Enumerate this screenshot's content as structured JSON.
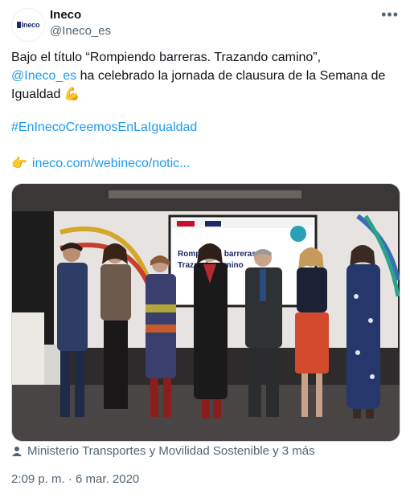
{
  "author": {
    "avatar_text": "Ineco",
    "name": "Ineco",
    "handle": "@Ineco_es"
  },
  "tweet": {
    "line1": "Bajo el título “Rompiendo barreras. Trazando camino”,",
    "mention": "@Ineco_es",
    "line2_rest": " ha celebrado la jornada de clausura de la Semana de Igualdad",
    "flex_emoji": "💪",
    "hashtag": "#EnInecoCreemosEnLaIgualdad",
    "pointing_emoji": "👉",
    "url": "ineco.com/webineco/notic..."
  },
  "photo": {
    "screen_title_1": "Rompiendo barreras.",
    "screen_title_2": "Trazando camino"
  },
  "location_text": "Ministerio Transportes y Movilidad Sostenible y 3 más",
  "timestamp": "2:09 p. m. · 6 mar. 2020",
  "icons": {
    "more": "more-options-icon",
    "person": "person-tag-icon"
  }
}
